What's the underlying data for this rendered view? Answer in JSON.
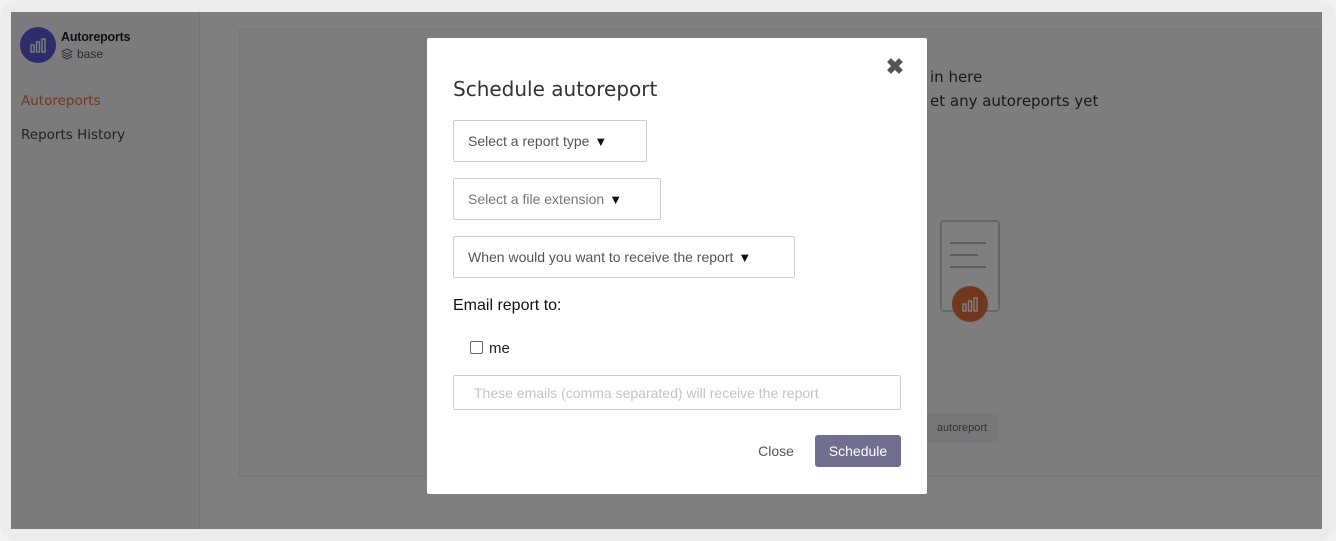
{
  "sidebar": {
    "brand_title": "Autoreports",
    "brand_subtitle": "base",
    "items": [
      {
        "label": "Autoreports",
        "active": true
      },
      {
        "label": "Reports History",
        "active": false
      }
    ]
  },
  "main": {
    "empty_line1": "in here",
    "empty_line2": "et any autoreports yet",
    "create_button_label": "autoreport"
  },
  "modal": {
    "title": "Schedule autoreport",
    "close_icon": "close-icon",
    "report_type_placeholder": "Select a report type",
    "file_extension_placeholder": "Select a file extension",
    "schedule_placeholder": "When would you want to receive the report",
    "dropdown_arrow": "▼",
    "email_label": "Email report to:",
    "me_label": "me",
    "me_checked": false,
    "emails_placeholder": "These emails (comma separated) will receive the report",
    "emails_value": "",
    "close_label": "Close",
    "schedule_label": "Schedule"
  },
  "colors": {
    "accent": "#e0703d",
    "brand": "#5b5bd6",
    "schedule_button": "#6f6e8f",
    "overlay": "rgba(0,0,0,0.5)"
  }
}
